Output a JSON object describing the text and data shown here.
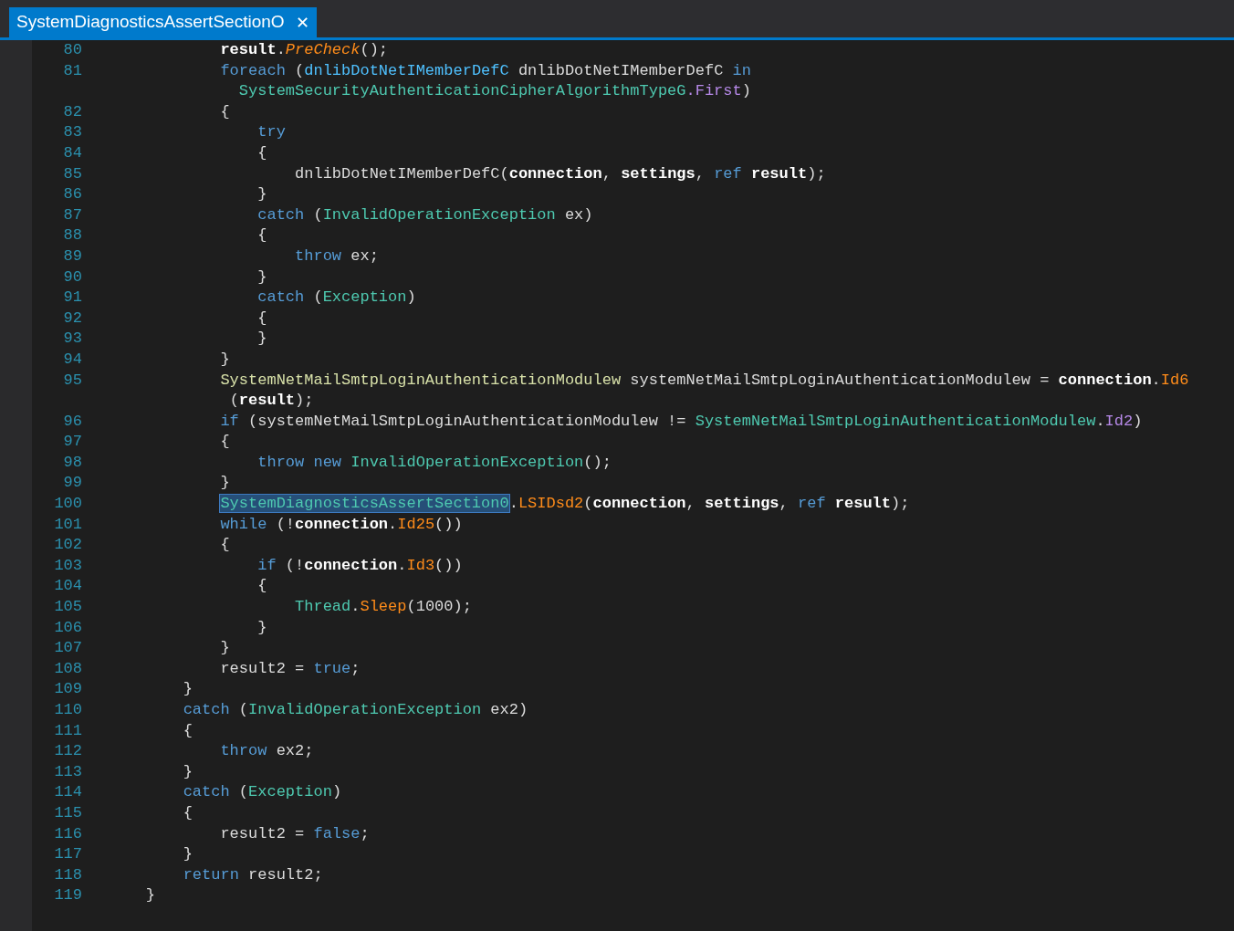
{
  "tab": {
    "title": "SystemDiagnosticsAssertSectionO",
    "close": "✕",
    "selected": true
  },
  "lines": [
    {
      "number": "80",
      "rows": [
        {
          "t": [
            {
              "text": "            result",
              "kind": "local"
            },
            {
              "text": ".",
              "kind": "plain"
            },
            {
              "text": "PreCheck",
              "kind": "italic"
            },
            {
              "text": "();",
              "kind": "plain"
            }
          ]
        }
      ]
    },
    {
      "number": "81",
      "rows": [
        {
          "t": [
            {
              "text": "            foreach",
              "kind": "kw"
            },
            {
              "text": " (",
              "kind": "plain"
            },
            {
              "text": "dnlibDotNetIMemberDefC",
              "kind": "type2"
            },
            {
              "text": " dnlibDotNetIMemberDefC ",
              "kind": "plain"
            },
            {
              "text": "in",
              "kind": "kw"
            }
          ]
        },
        {
          "t": [
            {
              "text": "              SystemSecurityAuthenticationCipherAlgorithmTypeG",
              "kind": "type"
            },
            {
              "text": ".First",
              "kind": "prop"
            },
            {
              "text": ")",
              "kind": "plain"
            }
          ]
        }
      ]
    },
    {
      "number": "82",
      "rows": [
        {
          "t": [
            {
              "text": "            {",
              "kind": "plain"
            }
          ]
        }
      ]
    },
    {
      "number": "83",
      "rows": [
        {
          "t": [
            {
              "text": "                try",
              "kind": "kw"
            }
          ]
        }
      ]
    },
    {
      "number": "84",
      "rows": [
        {
          "t": [
            {
              "text": "                {",
              "kind": "plain"
            }
          ]
        }
      ]
    },
    {
      "number": "85",
      "rows": [
        {
          "t": [
            {
              "text": "                    dnlibDotNetIMemberDefC(",
              "kind": "plain"
            },
            {
              "text": "connection",
              "kind": "local"
            },
            {
              "text": ", ",
              "kind": "plain"
            },
            {
              "text": "settings",
              "kind": "local"
            },
            {
              "text": ", ",
              "kind": "plain"
            },
            {
              "text": "ref ",
              "kind": "kw"
            },
            {
              "text": "result",
              "kind": "local"
            },
            {
              "text": ");",
              "kind": "plain"
            }
          ]
        }
      ]
    },
    {
      "number": "86",
      "rows": [
        {
          "t": [
            {
              "text": "                }",
              "kind": "plain"
            }
          ]
        }
      ]
    },
    {
      "number": "87",
      "rows": [
        {
          "t": [
            {
              "text": "                catch",
              "kind": "kw"
            },
            {
              "text": " (",
              "kind": "plain"
            },
            {
              "text": "InvalidOperationException",
              "kind": "type"
            },
            {
              "text": " ex)",
              "kind": "plain"
            }
          ]
        }
      ]
    },
    {
      "number": "88",
      "rows": [
        {
          "t": [
            {
              "text": "                {",
              "kind": "plain"
            }
          ]
        }
      ]
    },
    {
      "number": "89",
      "rows": [
        {
          "t": [
            {
              "text": "                    throw",
              "kind": "kw"
            },
            {
              "text": " ex;",
              "kind": "plain"
            }
          ]
        }
      ]
    },
    {
      "number": "90",
      "rows": [
        {
          "t": [
            {
              "text": "                }",
              "kind": "plain"
            }
          ]
        }
      ]
    },
    {
      "number": "91",
      "rows": [
        {
          "t": [
            {
              "text": "                catch",
              "kind": "kw"
            },
            {
              "text": " (",
              "kind": "plain"
            },
            {
              "text": "Exception",
              "kind": "type"
            },
            {
              "text": ")",
              "kind": "plain"
            }
          ]
        }
      ]
    },
    {
      "number": "92",
      "rows": [
        {
          "t": [
            {
              "text": "                {",
              "kind": "plain"
            }
          ]
        }
      ]
    },
    {
      "number": "93",
      "rows": [
        {
          "t": [
            {
              "text": "                }",
              "kind": "plain"
            }
          ]
        }
      ]
    },
    {
      "number": "94",
      "rows": [
        {
          "t": [
            {
              "text": "            }",
              "kind": "plain"
            }
          ]
        }
      ]
    },
    {
      "number": "95",
      "rows": [
        {
          "t": [
            {
              "text": "            SystemNetMailSmtpLoginAuthenticationModulew",
              "kind": "typey"
            },
            {
              "text": " systemNetMailSmtpLoginAuthenticationModulew = ",
              "kind": "plain"
            },
            {
              "text": "connection",
              "kind": "local"
            },
            {
              "text": ".",
              "kind": "plain"
            },
            {
              "text": "Id6",
              "kind": "method"
            }
          ]
        },
        {
          "t": [
            {
              "text": "             (",
              "kind": "plain"
            },
            {
              "text": "result",
              "kind": "local"
            },
            {
              "text": ");",
              "kind": "plain"
            }
          ]
        }
      ]
    },
    {
      "number": "96",
      "rows": [
        {
          "t": [
            {
              "text": "            if",
              "kind": "kw"
            },
            {
              "text": " (systemNetMailSmtpLoginAuthenticationModulew != ",
              "kind": "plain"
            },
            {
              "text": "SystemNetMailSmtpLoginAuthenticationModulew",
              "kind": "type"
            },
            {
              "text": ".",
              "kind": "plain"
            },
            {
              "text": "Id2",
              "kind": "prop"
            },
            {
              "text": ")",
              "kind": "plain"
            }
          ]
        }
      ]
    },
    {
      "number": "97",
      "rows": [
        {
          "t": [
            {
              "text": "            {",
              "kind": "plain"
            }
          ]
        }
      ]
    },
    {
      "number": "98",
      "rows": [
        {
          "t": [
            {
              "text": "                throw new",
              "kind": "kw"
            },
            {
              "text": " InvalidOperationException",
              "kind": "type"
            },
            {
              "text": "();",
              "kind": "plain"
            }
          ]
        }
      ]
    },
    {
      "number": "99",
      "rows": [
        {
          "t": [
            {
              "text": "            }",
              "kind": "plain"
            }
          ]
        }
      ]
    },
    {
      "number": "100",
      "rows": [
        {
          "t": [
            {
              "text": "            SystemDiagnosticsAssertSection0",
              "kind": "selected"
            },
            {
              "text": ".",
              "kind": "plain"
            },
            {
              "text": "LSIDsd2",
              "kind": "method"
            },
            {
              "text": "(",
              "kind": "plain"
            },
            {
              "text": "connection",
              "kind": "local"
            },
            {
              "text": ", ",
              "kind": "plain"
            },
            {
              "text": "settings",
              "kind": "local"
            },
            {
              "text": ", ",
              "kind": "plain"
            },
            {
              "text": "ref ",
              "kind": "kw"
            },
            {
              "text": "result",
              "kind": "local"
            },
            {
              "text": ");",
              "kind": "plain"
            }
          ]
        }
      ]
    },
    {
      "number": "101",
      "rows": [
        {
          "t": [
            {
              "text": "            while",
              "kind": "kw"
            },
            {
              "text": " (!",
              "kind": "plain"
            },
            {
              "text": "connection",
              "kind": "local"
            },
            {
              "text": ".",
              "kind": "plain"
            },
            {
              "text": "Id25",
              "kind": "method"
            },
            {
              "text": "())",
              "kind": "plain"
            }
          ]
        }
      ]
    },
    {
      "number": "102",
      "rows": [
        {
          "t": [
            {
              "text": "            {",
              "kind": "plain"
            }
          ]
        }
      ]
    },
    {
      "number": "103",
      "rows": [
        {
          "t": [
            {
              "text": "                if",
              "kind": "kw"
            },
            {
              "text": " (!",
              "kind": "plain"
            },
            {
              "text": "connection",
              "kind": "local"
            },
            {
              "text": ".",
              "kind": "plain"
            },
            {
              "text": "Id3",
              "kind": "method"
            },
            {
              "text": "())",
              "kind": "plain"
            }
          ]
        }
      ]
    },
    {
      "number": "104",
      "rows": [
        {
          "t": [
            {
              "text": "                {",
              "kind": "plain"
            }
          ]
        }
      ]
    },
    {
      "number": "105",
      "rows": [
        {
          "t": [
            {
              "text": "                    Thread",
              "kind": "type"
            },
            {
              "text": ".",
              "kind": "plain"
            },
            {
              "text": "Sleep",
              "kind": "method"
            },
            {
              "text": "(1000);",
              "kind": "plain"
            }
          ]
        }
      ]
    },
    {
      "number": "106",
      "rows": [
        {
          "t": [
            {
              "text": "                }",
              "kind": "plain"
            }
          ]
        }
      ]
    },
    {
      "number": "107",
      "rows": [
        {
          "t": [
            {
              "text": "            }",
              "kind": "plain"
            }
          ]
        }
      ]
    },
    {
      "number": "108",
      "rows": [
        {
          "t": [
            {
              "text": "            result2 = ",
              "kind": "plain"
            },
            {
              "text": "true",
              "kind": "kw"
            },
            {
              "text": ";",
              "kind": "plain"
            }
          ]
        }
      ]
    },
    {
      "number": "109",
      "rows": [
        {
          "t": [
            {
              "text": "        }",
              "kind": "plain"
            }
          ]
        }
      ]
    },
    {
      "number": "110",
      "rows": [
        {
          "t": [
            {
              "text": "        catch",
              "kind": "kw"
            },
            {
              "text": " (",
              "kind": "plain"
            },
            {
              "text": "InvalidOperationException",
              "kind": "type"
            },
            {
              "text": " ex2)",
              "kind": "plain"
            }
          ]
        }
      ]
    },
    {
      "number": "111",
      "rows": [
        {
          "t": [
            {
              "text": "        {",
              "kind": "plain"
            }
          ]
        }
      ]
    },
    {
      "number": "112",
      "rows": [
        {
          "t": [
            {
              "text": "            throw",
              "kind": "kw"
            },
            {
              "text": " ex2;",
              "kind": "plain"
            }
          ]
        }
      ]
    },
    {
      "number": "113",
      "rows": [
        {
          "t": [
            {
              "text": "        }",
              "kind": "plain"
            }
          ]
        }
      ]
    },
    {
      "number": "114",
      "rows": [
        {
          "t": [
            {
              "text": "        catch",
              "kind": "kw"
            },
            {
              "text": " (",
              "kind": "plain"
            },
            {
              "text": "Exception",
              "kind": "type"
            },
            {
              "text": ")",
              "kind": "plain"
            }
          ]
        }
      ]
    },
    {
      "number": "115",
      "rows": [
        {
          "t": [
            {
              "text": "        {",
              "kind": "plain"
            }
          ]
        }
      ]
    },
    {
      "number": "116",
      "rows": [
        {
          "t": [
            {
              "text": "            result2 = ",
              "kind": "plain"
            },
            {
              "text": "false",
              "kind": "kw"
            },
            {
              "text": ";",
              "kind": "plain"
            }
          ]
        }
      ]
    },
    {
      "number": "117",
      "rows": [
        {
          "t": [
            {
              "text": "        }",
              "kind": "plain"
            }
          ]
        }
      ]
    },
    {
      "number": "118",
      "rows": [
        {
          "t": [
            {
              "text": "        return",
              "kind": "kw"
            },
            {
              "text": " result2;",
              "kind": "plain"
            }
          ]
        }
      ]
    },
    {
      "number": "119",
      "rows": [
        {
          "t": [
            {
              "text": "    }",
              "kind": "plain"
            }
          ]
        }
      ]
    }
  ]
}
